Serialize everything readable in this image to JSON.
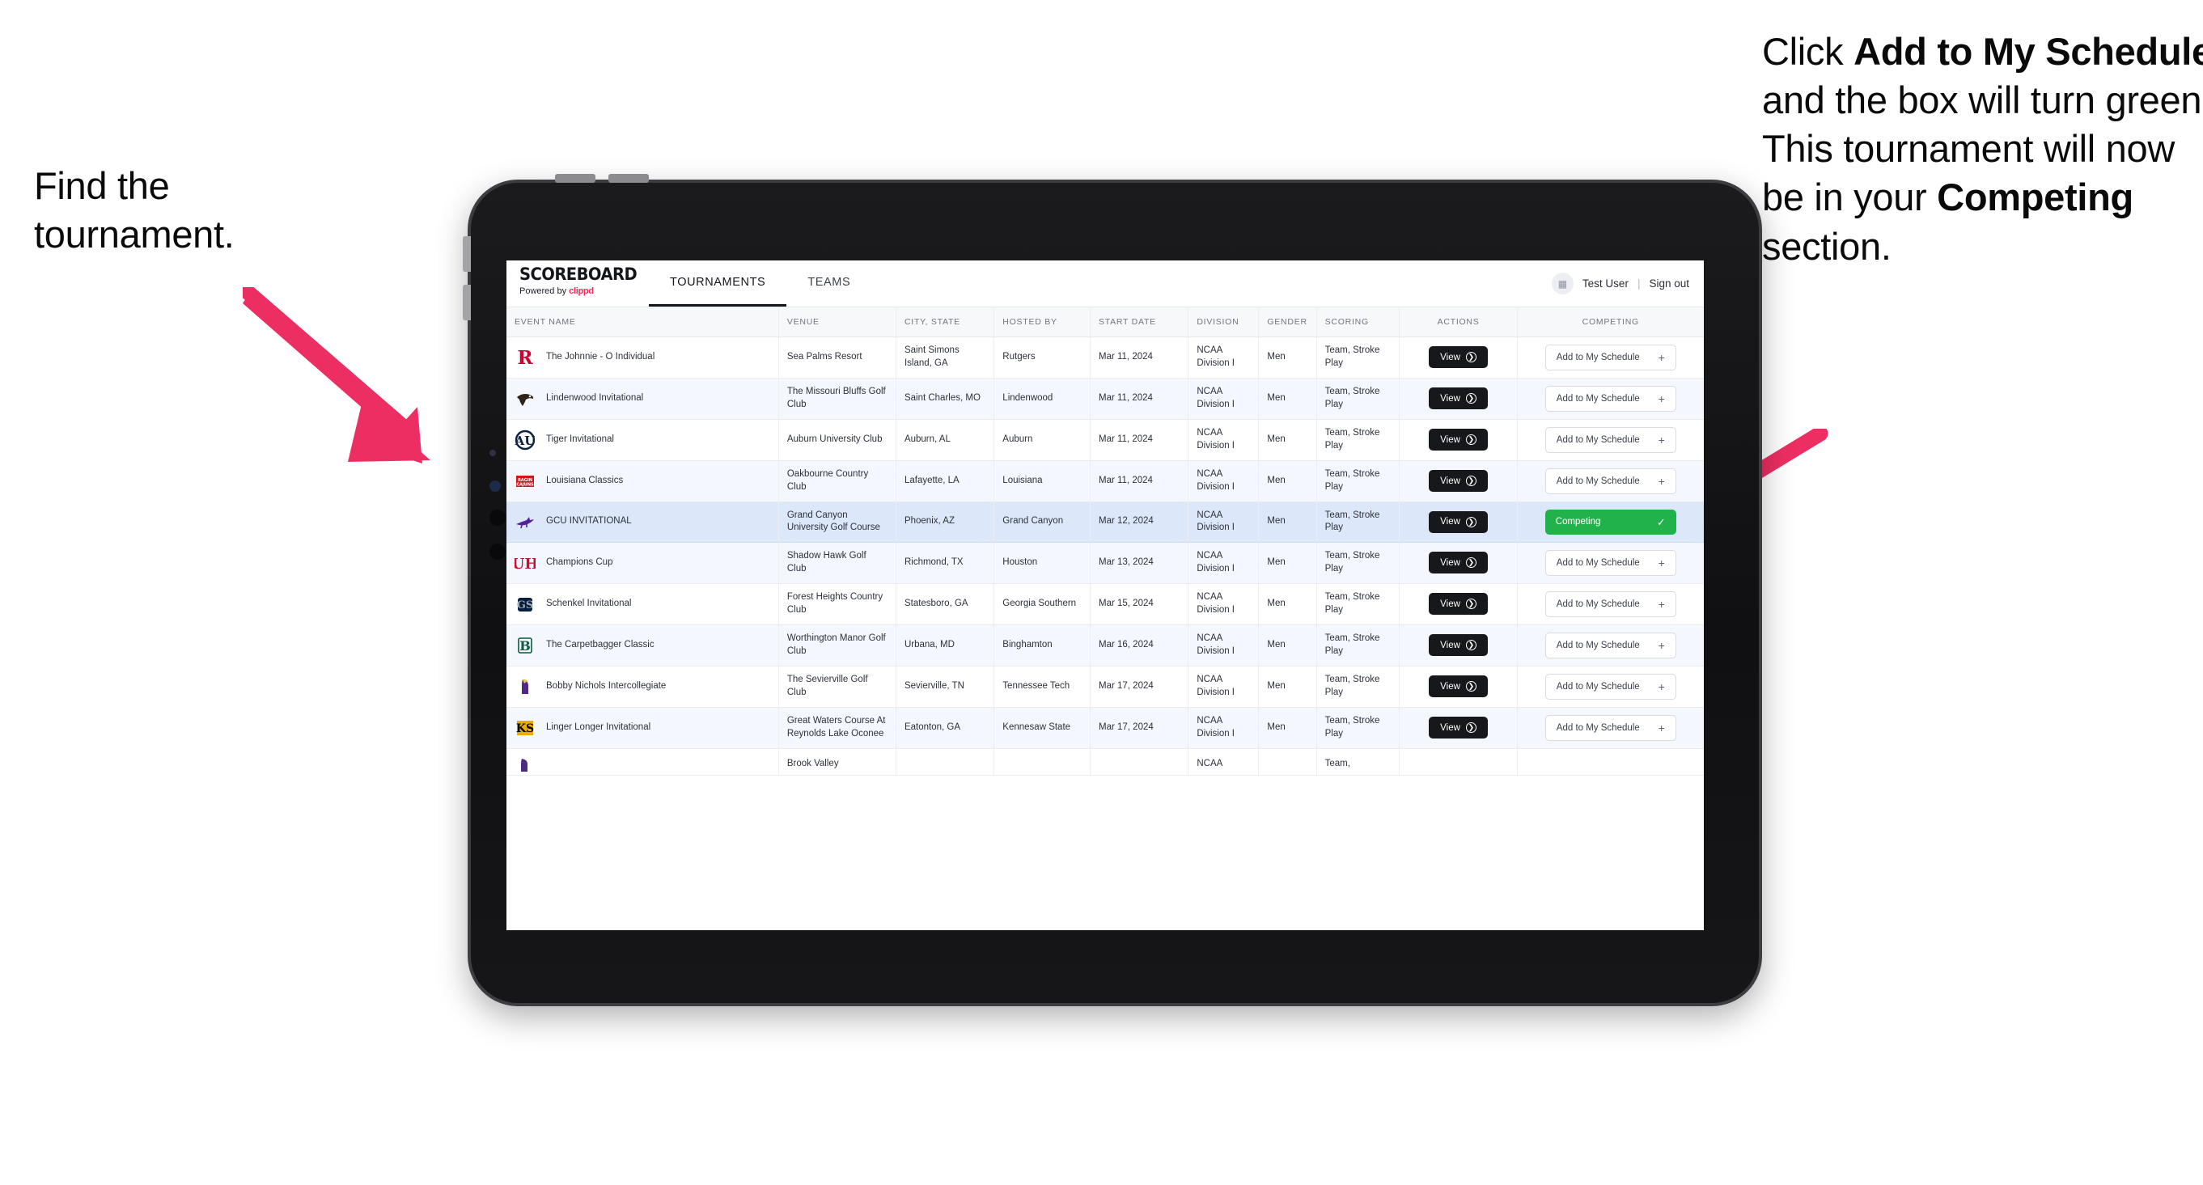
{
  "annotations": {
    "left": {
      "line1": "Find the",
      "line2": "tournament."
    },
    "right": {
      "seg1": "Click ",
      "bold1": "Add to My Schedule",
      "seg2": " and the box will turn green. This tournament will now be in your ",
      "bold2": "Competing",
      "seg3": " section."
    },
    "arrow_color": "#ed2e63"
  },
  "app": {
    "brand": {
      "title": "SCOREBOARD",
      "powered_prefix": "Powered by ",
      "powered_name": "clippd"
    },
    "nav": [
      {
        "label": "TOURNAMENTS",
        "active": true
      },
      {
        "label": "TEAMS",
        "active": false
      }
    ],
    "account": {
      "avatar_icon": "user-avatar-icon",
      "user": "Test User",
      "separator": "|",
      "signout": "Sign out"
    }
  },
  "table": {
    "columns": [
      "EVENT NAME",
      "VENUE",
      "CITY, STATE",
      "HOSTED BY",
      "START DATE",
      "DIVISION",
      "GENDER",
      "SCORING",
      "ACTIONS",
      "COMPETING"
    ],
    "labels": {
      "view": "View",
      "add": "Add to My Schedule",
      "add_icon": "plus-icon",
      "competing": "Competing",
      "competing_icon": "check-icon",
      "view_icon": "arrow-right-circle-icon"
    },
    "rows": [
      {
        "event": "The Johnnie - O Individual",
        "venue": "Sea Palms Resort",
        "city": "Saint Simons Island, GA",
        "hosted": "Rutgers",
        "date": "Mar 11, 2024",
        "division": "NCAA Division I",
        "gender": "Men",
        "scoring": "Team, Stroke Play",
        "competing": false,
        "logo": "rutgers-logo"
      },
      {
        "event": "Lindenwood Invitational",
        "venue": "The Missouri Bluffs Golf Club",
        "city": "Saint Charles, MO",
        "hosted": "Lindenwood",
        "date": "Mar 11, 2024",
        "division": "NCAA Division I",
        "gender": "Men",
        "scoring": "Team, Stroke Play",
        "competing": false,
        "logo": "lindenwood-logo"
      },
      {
        "event": "Tiger Invitational",
        "venue": "Auburn University Club",
        "city": "Auburn, AL",
        "hosted": "Auburn",
        "date": "Mar 11, 2024",
        "division": "NCAA Division I",
        "gender": "Men",
        "scoring": "Team, Stroke Play",
        "competing": false,
        "logo": "auburn-logo"
      },
      {
        "event": "Louisiana Classics",
        "venue": "Oakbourne Country Club",
        "city": "Lafayette, LA",
        "hosted": "Louisiana",
        "date": "Mar 11, 2024",
        "division": "NCAA Division I",
        "gender": "Men",
        "scoring": "Team, Stroke Play",
        "competing": false,
        "logo": "ragin-cajuns-logo"
      },
      {
        "event": "GCU INVITATIONAL",
        "venue": "Grand Canyon University Golf Course",
        "city": "Phoenix, AZ",
        "hosted": "Grand Canyon",
        "date": "Mar 12, 2024",
        "division": "NCAA Division I",
        "gender": "Men",
        "scoring": "Team, Stroke Play",
        "competing": true,
        "logo": "grand-canyon-lopes-logo"
      },
      {
        "event": "Champions Cup",
        "venue": "Shadow Hawk Golf Club",
        "city": "Richmond, TX",
        "hosted": "Houston",
        "date": "Mar 13, 2024",
        "division": "NCAA Division I",
        "gender": "Men",
        "scoring": "Team, Stroke Play",
        "competing": false,
        "logo": "houston-logo"
      },
      {
        "event": "Schenkel Invitational",
        "venue": "Forest Heights Country Club",
        "city": "Statesboro, GA",
        "hosted": "Georgia Southern",
        "date": "Mar 15, 2024",
        "division": "NCAA Division I",
        "gender": "Men",
        "scoring": "Team, Stroke Play",
        "competing": false,
        "logo": "georgia-southern-logo"
      },
      {
        "event": "The Carpetbagger Classic",
        "venue": "Worthington Manor Golf Club",
        "city": "Urbana, MD",
        "hosted": "Binghamton",
        "date": "Mar 16, 2024",
        "division": "NCAA Division I",
        "gender": "Men",
        "scoring": "Team, Stroke Play",
        "competing": false,
        "logo": "binghamton-logo"
      },
      {
        "event": "Bobby Nichols Intercollegiate",
        "venue": "The Sevierville Golf Club",
        "city": "Sevierville, TN",
        "hosted": "Tennessee Tech",
        "date": "Mar 17, 2024",
        "division": "NCAA Division I",
        "gender": "Men",
        "scoring": "Team, Stroke Play",
        "competing": false,
        "logo": "tennessee-tech-logo"
      },
      {
        "event": "Linger Longer Invitational",
        "venue": "Great Waters Course At Reynolds Lake Oconee",
        "city": "Eatonton, GA",
        "hosted": "Kennesaw State",
        "date": "Mar 17, 2024",
        "division": "NCAA Division I",
        "gender": "Men",
        "scoring": "Team, Stroke Play",
        "competing": false,
        "logo": "kennesaw-state-logo"
      }
    ],
    "partial_row": {
      "venue": "Brook Valley",
      "division": "NCAA",
      "scoring": "Team,"
    }
  }
}
